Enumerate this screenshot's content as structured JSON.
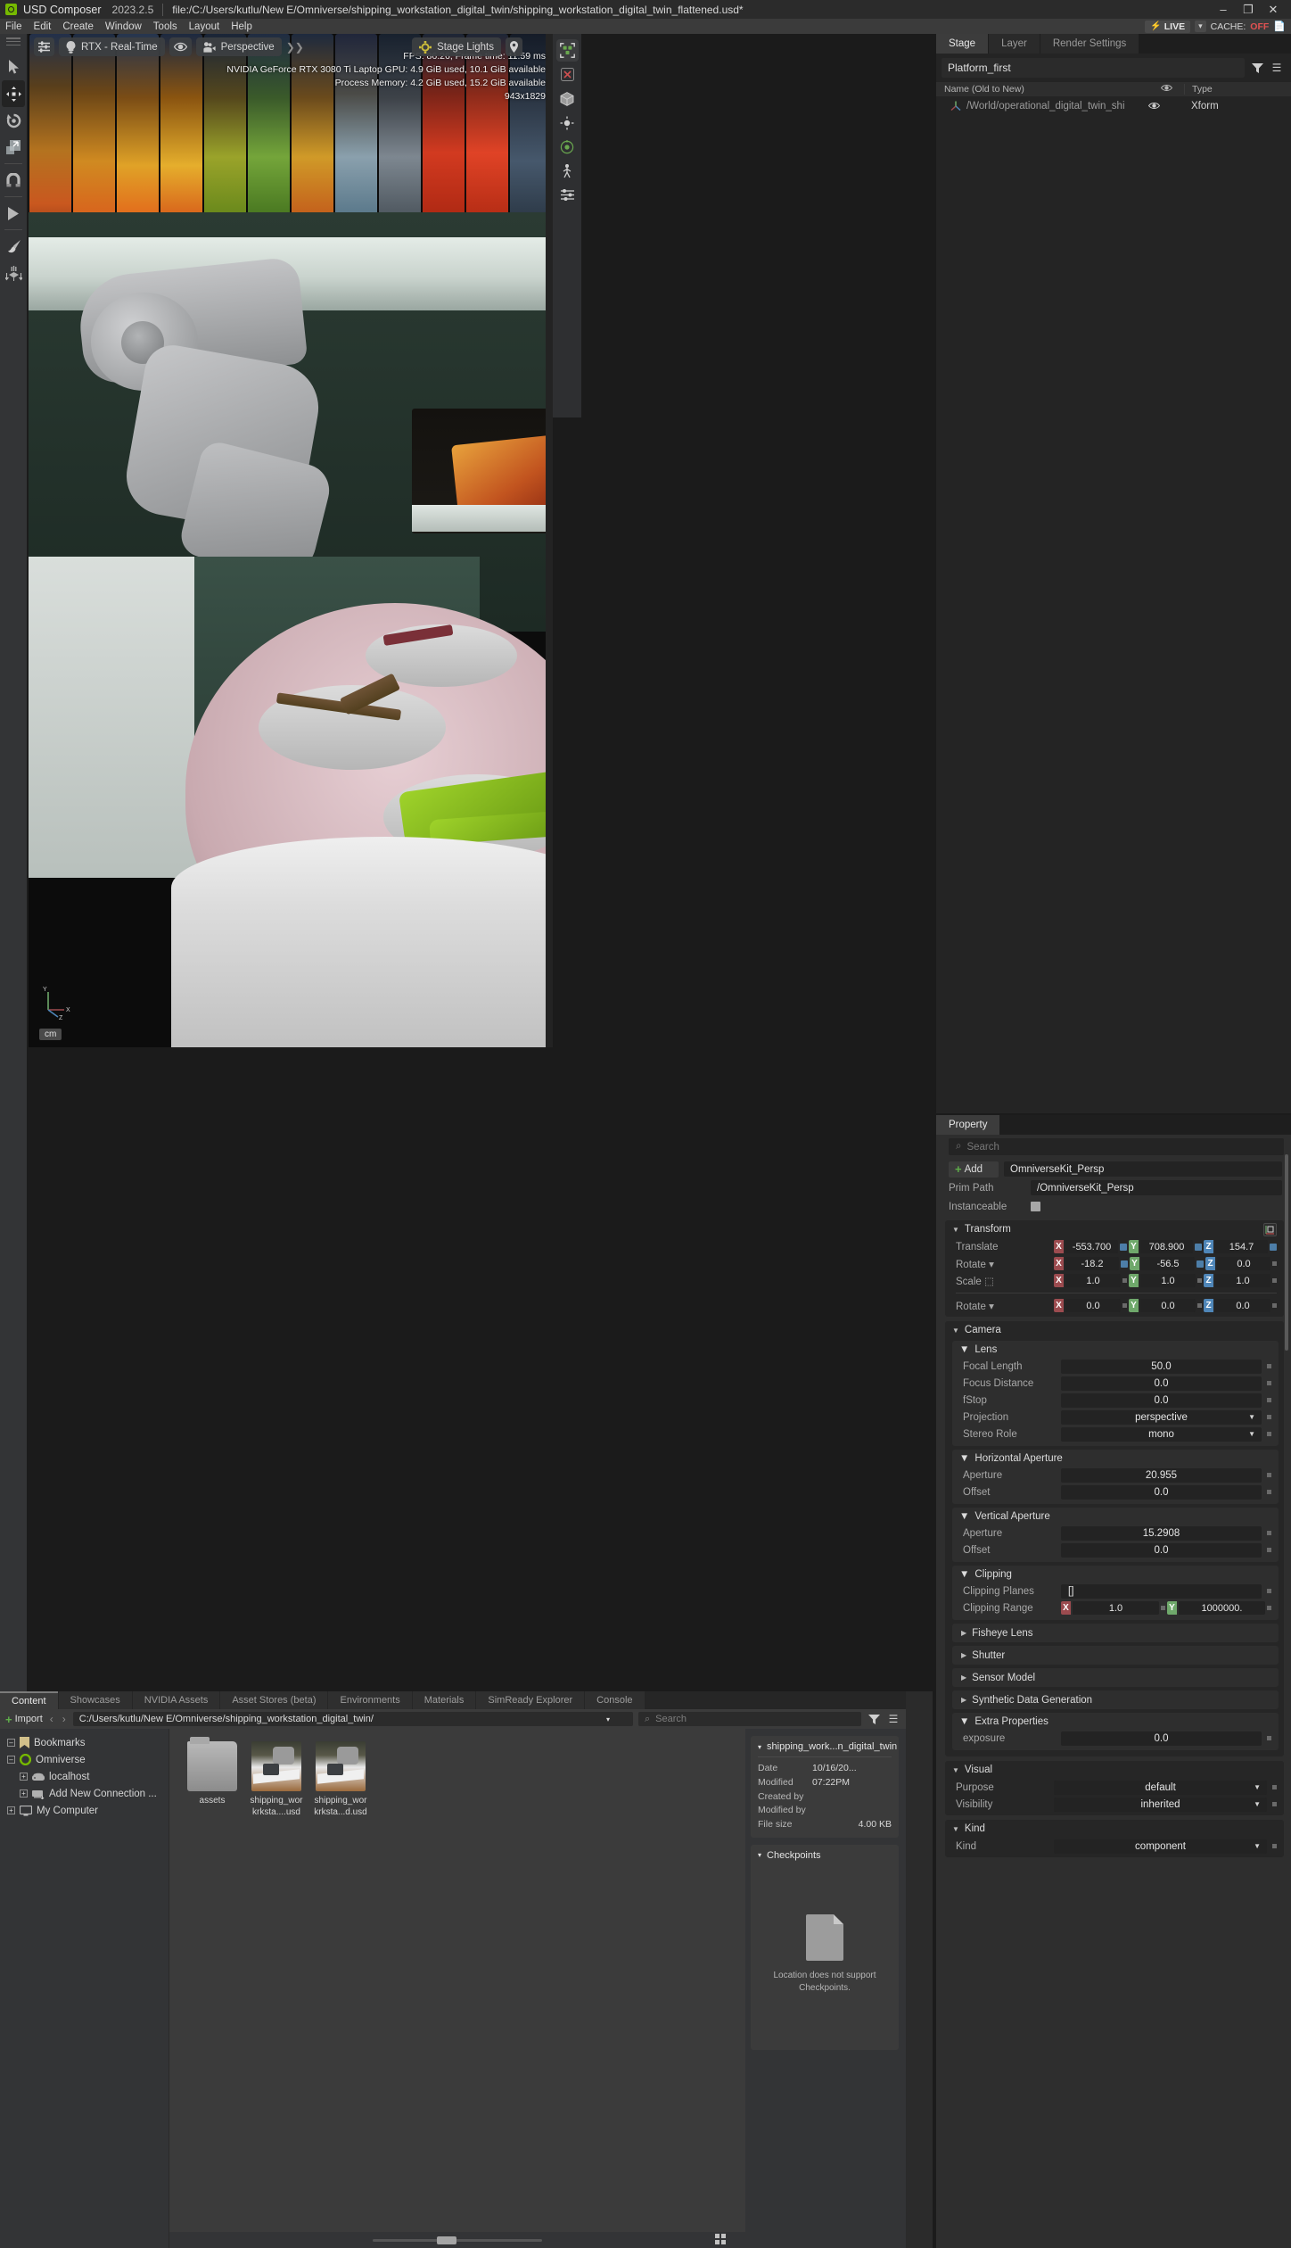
{
  "titlebar": {
    "app": "USD Composer",
    "version": "2023.2.5",
    "file_path": "file:/C:/Users/kutlu/New E/Omniverse/shipping_workstation_digital_twin/shipping_workstation_digital_twin_flattened.usd*",
    "minimize": "–",
    "maximize": "❐",
    "close": "✕"
  },
  "menubar": {
    "items": [
      "File",
      "Edit",
      "Create",
      "Window",
      "Tools",
      "Layout",
      "Help"
    ]
  },
  "status": {
    "live_label": "LIVE",
    "bolt": "⚡",
    "chevron": "▾",
    "cache_label": "CACHE:",
    "cache_value": "OFF"
  },
  "toolrail": {
    "items": [
      {
        "name": "select-tool",
        "glyph": "➤"
      },
      {
        "name": "move-tool",
        "glyph": "✥"
      },
      {
        "name": "rotate-tool",
        "glyph": "↻"
      },
      {
        "name": "scale-tool",
        "glyph": "⬚"
      },
      {
        "name": "snap-tool",
        "glyph": "⛓"
      },
      {
        "name": "play-tool",
        "glyph": "▶"
      },
      {
        "name": "paint-tool",
        "glyph": "✎"
      },
      {
        "name": "physics-drop-tool",
        "glyph": "⬇"
      }
    ]
  },
  "viewport": {
    "settings_icon": "⚙",
    "renderer": "RTX - Real-Time",
    "renderer_icon": "lightbulb-icon",
    "eye_icon": "◉",
    "camera_icon": "camera-icon",
    "camera": "Perspective",
    "expander": "❯❯",
    "lights_label": "Stage Lights",
    "lights_icon": "sun-icon",
    "pin_icon": "⊙",
    "stats": {
      "fps": "FPS: 86.26, Frame time: 11.59 ms",
      "gpu": "NVIDIA GeForce RTX 3080 Ti Laptop GPU: 4.9 GiB used, 10.1 GiB available",
      "memory": "Process Memory: 4.2 GiB used, 15.2 GiB available",
      "resolution": "943x1829"
    },
    "unit": "cm",
    "axis_labels": {
      "x": "X",
      "y": "Y",
      "z": "Z"
    },
    "rail_icons": [
      {
        "name": "prim-select-icon",
        "glyph": "⬚"
      },
      {
        "name": "delete-icon",
        "glyph": "✕"
      },
      {
        "name": "cube-icon",
        "glyph": "⬛"
      },
      {
        "name": "light-icon",
        "glyph": "✺"
      },
      {
        "name": "physics-icon",
        "glyph": "⚙"
      },
      {
        "name": "skeleton-icon",
        "glyph": "☸"
      },
      {
        "name": "sliders-icon",
        "glyph": "☰"
      }
    ]
  },
  "stage": {
    "tabs": [
      {
        "label": "Stage",
        "active": true
      },
      {
        "label": "Layer",
        "active": false
      },
      {
        "label": "Render Settings",
        "active": false
      }
    ],
    "search_value": "Platform_first",
    "filter_icon": "ᐳ",
    "menu_icon": "☰",
    "columns": {
      "name": "Name (Old to New)",
      "visibility": "◉",
      "type": "Type"
    },
    "rows": [
      {
        "name": "/World/operational_digital_twin_shi",
        "visibility": "◉",
        "type": "Xform",
        "icon": "xform-axis-icon"
      }
    ]
  },
  "property": {
    "tab_label": "Property",
    "search_placeholder": "Search",
    "search_icon": "⌕",
    "add_label": "Add",
    "add_icon": "+",
    "name_value": "OmniverseKit_Persp",
    "prim_path_label": "Prim Path",
    "prim_path_value": "/OmniverseKit_Persp",
    "instanceable_label": "Instanceable",
    "transform": {
      "title": "Transform",
      "rows": [
        {
          "label": "Translate",
          "type": "xyz",
          "x": "-553.700",
          "y": "708.900",
          "z": "154.7",
          "link": true
        },
        {
          "label": "Rotate ▾",
          "type": "xyz",
          "x": "-18.2",
          "y": "-56.5",
          "z": "0.0",
          "link": true
        },
        {
          "label": "Scale ⬚",
          "type": "xyz",
          "x": "1.0",
          "y": "1.0",
          "z": "1.0",
          "link": false
        },
        {
          "label": "Rotate ▾",
          "type": "xyz",
          "x": "0.0",
          "y": "0.0",
          "z": "0.0",
          "link": false
        }
      ]
    },
    "camera": {
      "title": "Camera",
      "lens": {
        "title": "Lens",
        "rows": [
          {
            "label": "Focal Length",
            "value": "50.0",
            "kind": "field"
          },
          {
            "label": "Focus Distance",
            "value": "0.0",
            "kind": "field"
          },
          {
            "label": "fStop",
            "value": "0.0",
            "kind": "field"
          },
          {
            "label": "Projection",
            "value": "perspective",
            "kind": "dropdown"
          },
          {
            "label": "Stereo Role",
            "value": "mono",
            "kind": "dropdown"
          }
        ]
      },
      "horizontal_aperture": {
        "title": "Horizontal Aperture",
        "rows": [
          {
            "label": "Aperture",
            "value": "20.955",
            "kind": "field"
          },
          {
            "label": "Offset",
            "value": "0.0",
            "kind": "field"
          }
        ]
      },
      "vertical_aperture": {
        "title": "Vertical Aperture",
        "rows": [
          {
            "label": "Aperture",
            "value": "15.2908",
            "kind": "field"
          },
          {
            "label": "Offset",
            "value": "0.0",
            "kind": "field"
          }
        ]
      },
      "clipping": {
        "title": "Clipping",
        "planes_label": "Clipping Planes",
        "planes_value": "[]",
        "range_label": "Clipping Range",
        "range_x": "1.0",
        "range_y": "1000000."
      },
      "collapsed_sections": [
        "Fisheye Lens",
        "Shutter",
        "Sensor Model",
        "Synthetic Data Generation"
      ],
      "extra": {
        "title": "Extra Properties",
        "rows": [
          {
            "label": "exposure",
            "value": "0.0",
            "kind": "field"
          }
        ]
      }
    },
    "visual": {
      "title": "Visual",
      "rows": [
        {
          "label": "Purpose",
          "value": "default",
          "kind": "dropdown"
        },
        {
          "label": "Visibility",
          "value": "inherited",
          "kind": "dropdown"
        }
      ]
    },
    "kind": {
      "title": "Kind",
      "rows": [
        {
          "label": "Kind",
          "value": "component",
          "kind": "dropdown"
        }
      ]
    }
  },
  "content": {
    "tabs": [
      {
        "label": "Content",
        "active": true
      },
      {
        "label": "Showcases",
        "active": false
      },
      {
        "label": "NVIDIA Assets",
        "active": false
      },
      {
        "label": "Asset Stores (beta)",
        "active": false
      },
      {
        "label": "Environments",
        "active": false
      },
      {
        "label": "Materials",
        "active": false
      },
      {
        "label": "SimReady Explorer",
        "active": false
      },
      {
        "label": "Console",
        "active": false
      }
    ],
    "import_label": "Import",
    "import_icon": "+",
    "back_icon": "‹",
    "forward_icon": "›",
    "path": "C:/Users/kutlu/New E/Omniverse/shipping_workstation_digital_twin/",
    "path_caret": "▾",
    "search_placeholder": "Search",
    "search_icon": "⌕",
    "filter_icon": "ᐳ",
    "menu_icon": "☰",
    "tree": [
      {
        "label": "Bookmarks",
        "depth": 0,
        "expander": "–",
        "icon": "bookmark-icon"
      },
      {
        "label": "Omniverse",
        "depth": 0,
        "expander": "–",
        "icon": "omniverse-icon"
      },
      {
        "label": "localhost",
        "depth": 1,
        "expander": "+",
        "icon": "server-icon"
      },
      {
        "label": "Add New Connection ...",
        "depth": 1,
        "expander": "+",
        "icon": "add-connection-icon"
      },
      {
        "label": "My Computer",
        "depth": 0,
        "expander": "+",
        "icon": "computer-icon"
      }
    ],
    "files": [
      {
        "name": "assets",
        "type": "folder"
      },
      {
        "name": "shipping_workrksta....usd",
        "type": "usd"
      },
      {
        "name": "shipping_workrksta...d.usd",
        "type": "usd"
      }
    ],
    "detail": {
      "title": "shipping_work...n_digital_twin",
      "tri": "▾",
      "rows": [
        {
          "label": "Date Modified",
          "value": "10/16/20... 07:22PM"
        },
        {
          "label": "Created by",
          "value": ""
        },
        {
          "label": "Modified by",
          "value": ""
        },
        {
          "label": "File size",
          "value": "4.00 KB"
        }
      ],
      "checkpoints_title": "Checkpoints",
      "checkpoints_message": "Location does not support Checkpoints."
    }
  }
}
